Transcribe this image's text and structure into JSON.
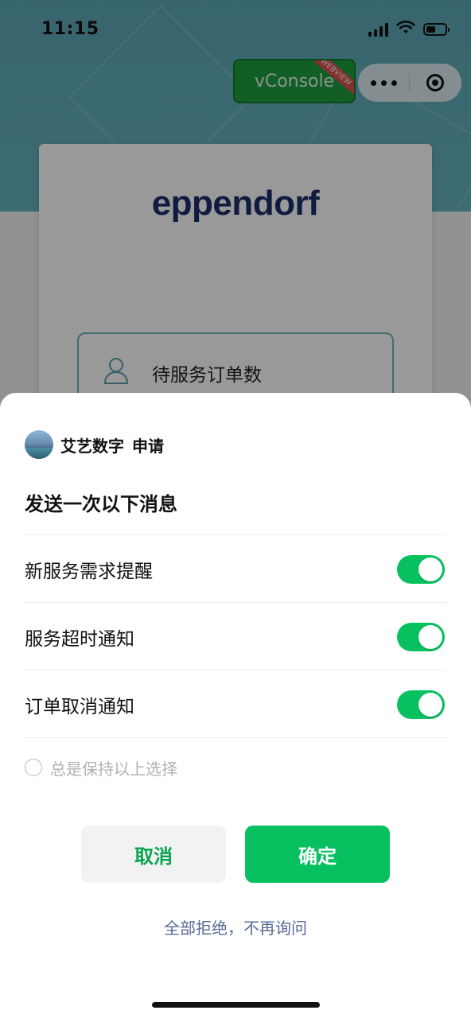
{
  "status_bar": {
    "time": "11:15"
  },
  "vconsole": {
    "label": "vConsole",
    "ribbon": "WEBVIEW"
  },
  "app": {
    "brand": "eppendorf",
    "field_label": "待服务订单数"
  },
  "sheet": {
    "applicant_name": "艾艺数字",
    "applicant_action": "申请",
    "title": "发送一次以下消息",
    "items": [
      {
        "label": "新服务需求提醒",
        "enabled": true
      },
      {
        "label": "服务超时通知",
        "enabled": true
      },
      {
        "label": "订单取消通知",
        "enabled": true
      }
    ],
    "remember_label": "总是保持以上选择",
    "cancel_label": "取消",
    "confirm_label": "确定",
    "reject_all_label": "全部拒绝，不再询问"
  },
  "colors": {
    "accent_green": "#07c160",
    "link_blue": "#576b95",
    "header_teal": "#5ea9b6",
    "brand_navy": "#1c2d6b"
  }
}
